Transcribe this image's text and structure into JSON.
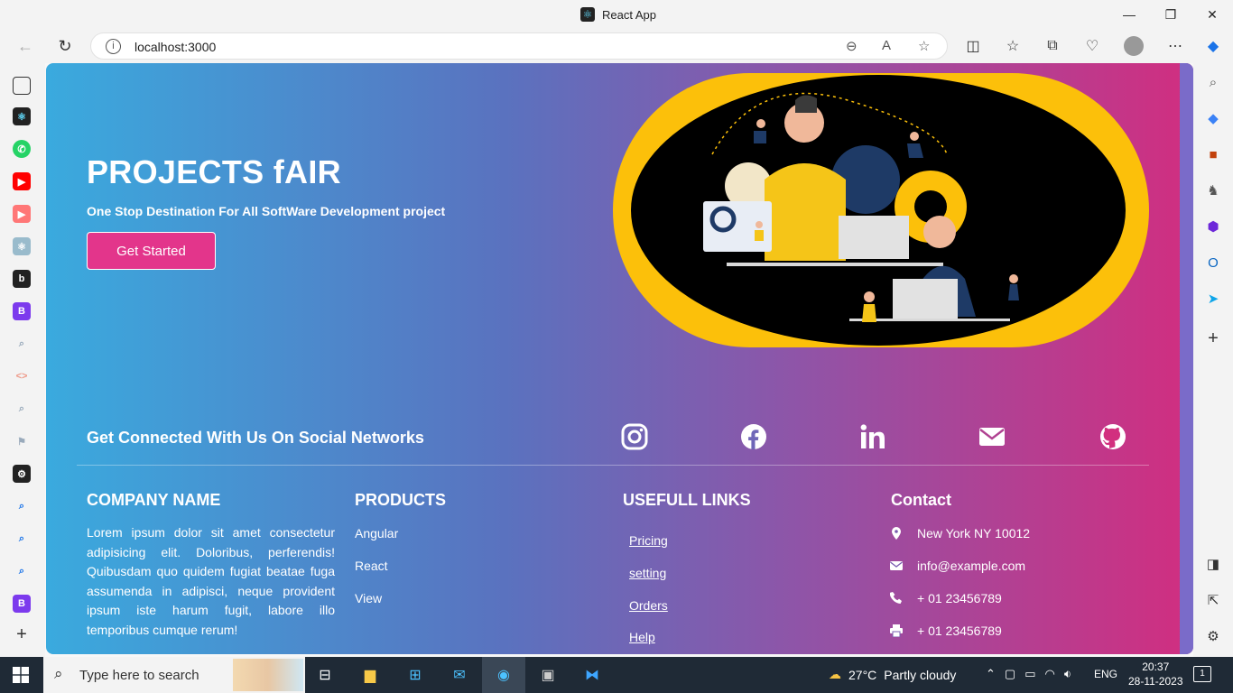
{
  "browser": {
    "tab_title": "React App",
    "url": "localhost:3000"
  },
  "hero": {
    "title": "PROJECTS fAIR",
    "subtitle": "One Stop Destination For All SoftWare Development project",
    "cta_label": "Get Started"
  },
  "social": {
    "heading": "Get Connected With Us On Social Networks",
    "icons": [
      "instagram-icon",
      "facebook-icon",
      "linkedin-icon",
      "envelope-icon",
      "github-icon"
    ]
  },
  "footer": {
    "company": {
      "heading": "COMPANY NAME",
      "text": "Lorem ipsum dolor sit amet consectetur adipisicing elit. Doloribus, perferendis! Quibusdam quo quidem fugiat beatae fuga assumenda in adipisci, neque provident ipsum iste harum fugit, labore illo temporibus cumque rerum!"
    },
    "products": {
      "heading": "PRODUCTS",
      "items": [
        "Angular",
        "React",
        "View"
      ]
    },
    "links": {
      "heading": "USEFULL LINKS",
      "items": [
        "Pricing",
        "setting",
        "Orders",
        "Help"
      ]
    },
    "contact": {
      "heading": "Contact",
      "address": "New York NY 10012",
      "email": "info@example.com",
      "phone": "+ 01 23456789",
      "fax": "+ 01 23456789"
    }
  },
  "taskbar": {
    "search_placeholder": "Type here to search",
    "temperature": "27°C",
    "weather": "Partly cloudy",
    "language": "ENG",
    "time": "20:37",
    "date": "28-11-2023",
    "notification_count": "1"
  },
  "colors": {
    "gradient_start": "#3aaade",
    "gradient_end": "#d12e80",
    "cta": "#e3358b",
    "hero_ring": "#fcc00a"
  }
}
